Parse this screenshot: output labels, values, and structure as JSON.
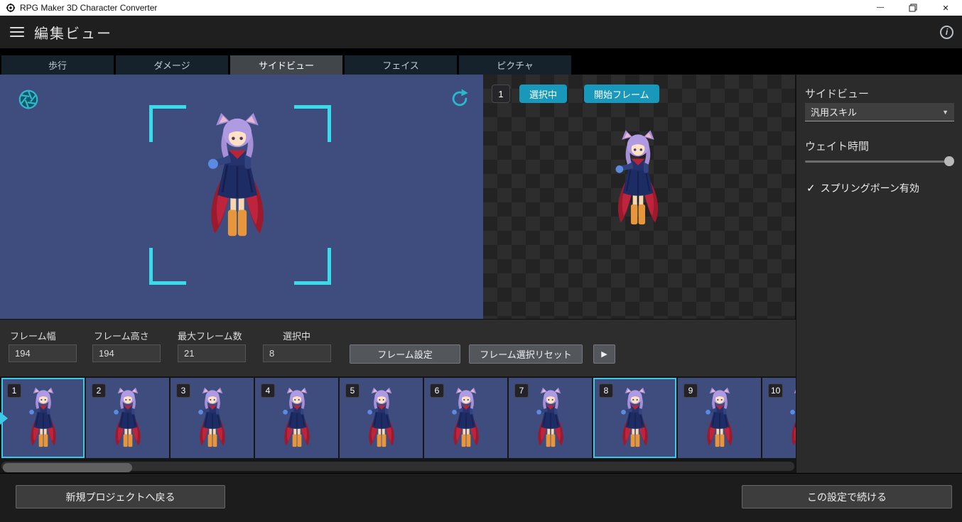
{
  "window": {
    "title": "RPG Maker 3D Character Converter"
  },
  "header": {
    "title": "編集ビュー"
  },
  "tabs": [
    {
      "label": "歩行",
      "active": false
    },
    {
      "label": "ダメージ",
      "active": false
    },
    {
      "label": "サイドビュー",
      "active": true
    },
    {
      "label": "フェイス",
      "active": false
    },
    {
      "label": "ピクチャ",
      "active": false
    }
  ],
  "preview": {
    "frame_badge": "1",
    "selected_label": "選択中",
    "start_frame_label": "開始フレーム"
  },
  "sidebar": {
    "title": "サイドビュー",
    "motion_dropdown": {
      "value": "汎用スキル"
    },
    "wait_time": {
      "label": "ウェイト時間",
      "slider_percent": 100
    },
    "spring_bone": {
      "label": "スプリングボーン有効",
      "checked": true
    }
  },
  "frame_settings": {
    "fields": [
      {
        "label": "フレーム幅",
        "value": "194"
      },
      {
        "label": "フレーム高さ",
        "value": "194"
      },
      {
        "label": "最大フレーム数",
        "value": "21"
      },
      {
        "label": "選択中",
        "value": "8"
      }
    ],
    "set_button": "フレーム設定",
    "reset_button": "フレーム選択リセット",
    "play_icon": "▶"
  },
  "frames": [
    {
      "number": "1",
      "selected": true
    },
    {
      "number": "2",
      "selected": false
    },
    {
      "number": "3",
      "selected": false
    },
    {
      "number": "4",
      "selected": false
    },
    {
      "number": "5",
      "selected": false
    },
    {
      "number": "6",
      "selected": false
    },
    {
      "number": "7",
      "selected": false
    },
    {
      "number": "8",
      "selected": true
    },
    {
      "number": "9",
      "selected": false
    },
    {
      "number": "10",
      "selected": false
    }
  ],
  "footer": {
    "back_button": "新規プロジェクトへ戻る",
    "continue_button": "この設定で続ける"
  },
  "icons": {
    "check": "✓",
    "chevron_down": "▼",
    "minimize": "—",
    "close": "✕",
    "info": "i"
  },
  "colors": {
    "accent_teal": "#1898ba",
    "selection_cyan": "#3cc9e8",
    "preview_blue": "#3e4d7e"
  }
}
